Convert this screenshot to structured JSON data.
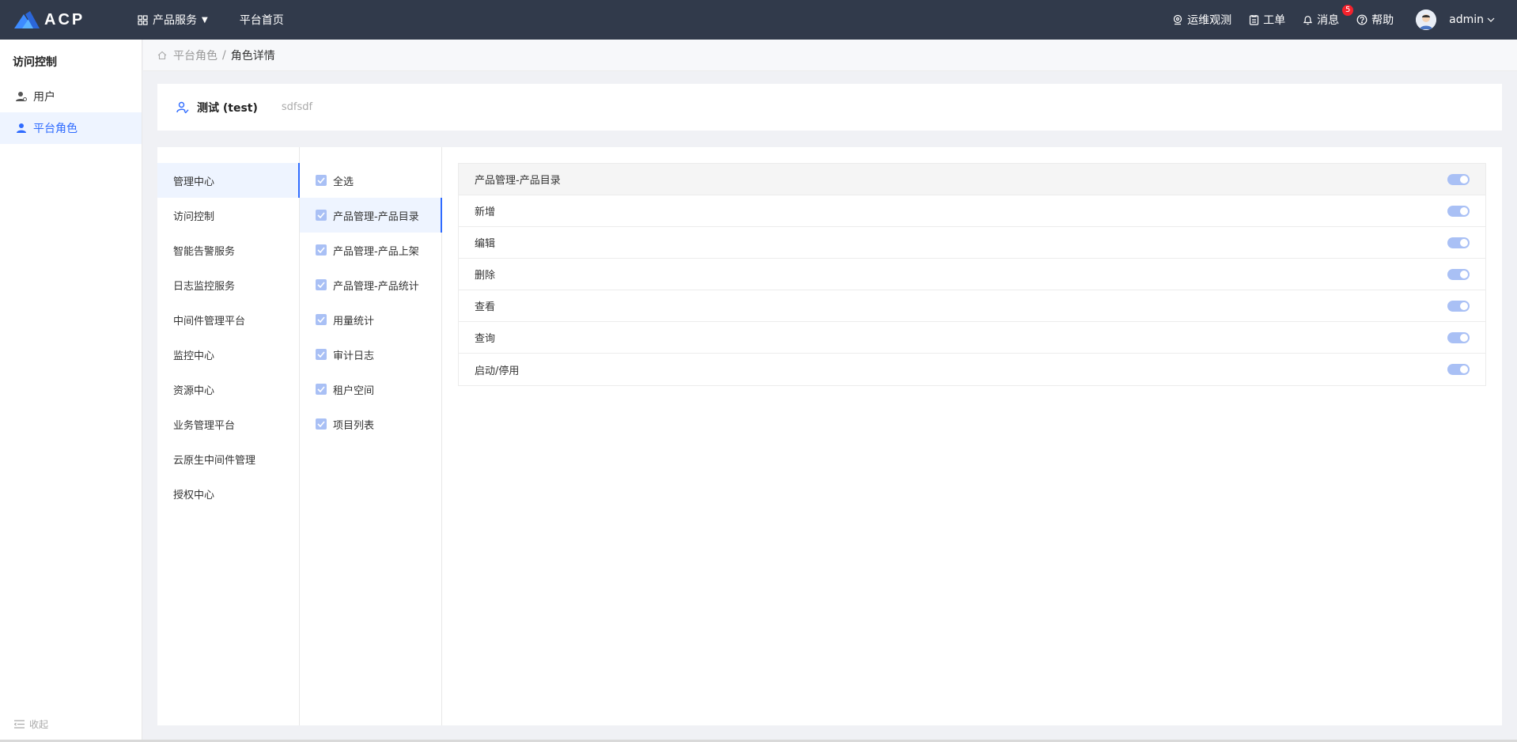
{
  "app": {
    "logo_text": "ACP",
    "nav": [
      {
        "label": "产品服务"
      },
      {
        "label": "平台首页"
      }
    ],
    "top_right": {
      "ops": "运维观测",
      "ticket": "工单",
      "messages": "消息",
      "messages_count": "5",
      "help": "帮助",
      "user": "admin"
    }
  },
  "sidebar": {
    "title": "访问控制",
    "items": [
      {
        "label": "用户"
      },
      {
        "label": "平台角色"
      }
    ],
    "collapse": "收起"
  },
  "breadcrumb": {
    "parent": "平台角色",
    "separator": "/",
    "current": "角色详情"
  },
  "role": {
    "name": "测试 (test)",
    "description": "sdfsdf"
  },
  "categories": [
    "管理中心",
    "访问控制",
    "智能告警服务",
    "日志监控服务",
    "中间件管理平台",
    "监控中心",
    "资源中心",
    "业务管理平台",
    "云原生中间件管理",
    "授权中心"
  ],
  "modules": [
    "全选",
    "产品管理-产品目录",
    "产品管理-产品上架",
    "产品管理-产品统计",
    "用量统计",
    "审计日志",
    "租户空间",
    "项目列表"
  ],
  "permissions": {
    "header": "产品管理-产品目录",
    "rows": [
      "新增",
      "编辑",
      "删除",
      "查看",
      "查询",
      "启动/停用"
    ]
  },
  "colors": {
    "topbar": "#313a4b",
    "accent": "#2f6bff",
    "toggle_on": "#a9c0f5"
  }
}
